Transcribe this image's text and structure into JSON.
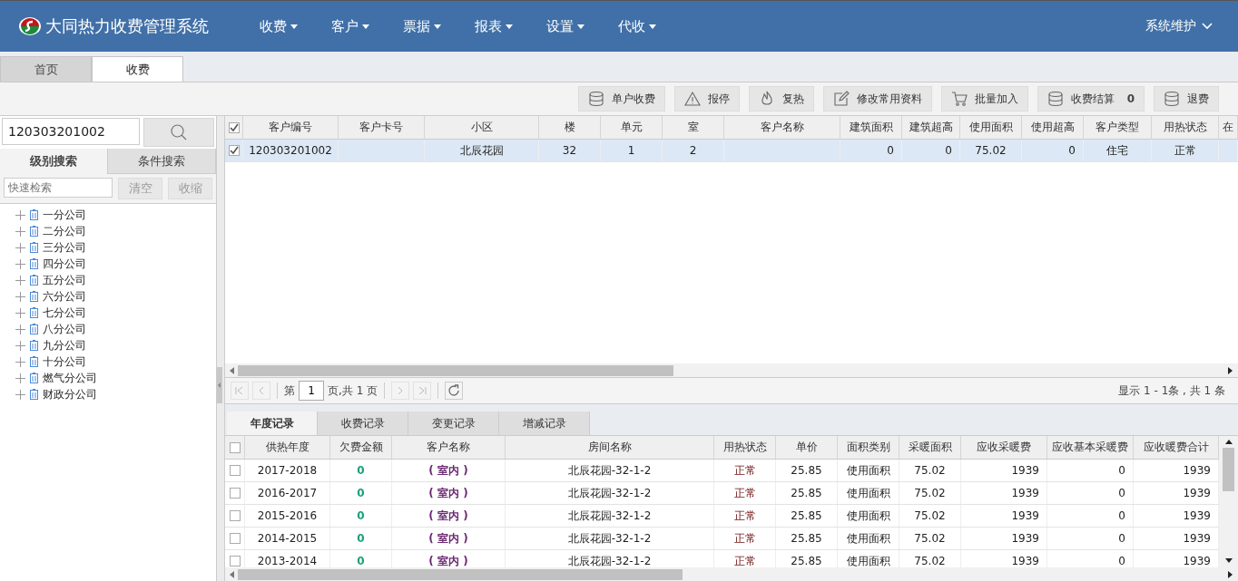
{
  "app": {
    "title": "大同热力收费管理系统",
    "menu": [
      {
        "label": "收费"
      },
      {
        "label": "客户"
      },
      {
        "label": "票据"
      },
      {
        "label": "报表"
      },
      {
        "label": "设置"
      },
      {
        "label": "代收"
      }
    ],
    "user_menu": "系统维护"
  },
  "page_tabs": [
    {
      "label": "首页",
      "selected": false
    },
    {
      "label": "收费",
      "selected": true
    }
  ],
  "toolbar": [
    {
      "label": "单户收费"
    },
    {
      "label": "报停"
    },
    {
      "label": "复热"
    },
    {
      "label": "修改常用资料"
    },
    {
      "label": "批量加入"
    },
    {
      "label": "收费结算",
      "count": "0"
    },
    {
      "label": "退费"
    }
  ],
  "sidebar": {
    "search_value": "120303201002",
    "tabs": [
      {
        "label": "级别搜索",
        "selected": true
      },
      {
        "label": "条件搜索",
        "selected": false
      }
    ],
    "filter_placeholder": "快速检索",
    "clear_button": "清空",
    "collapse_button": "收缩",
    "tree": [
      {
        "label": "一分公司",
        "expanded": false
      },
      {
        "label": "二分公司",
        "expanded": false
      },
      {
        "label": "三分公司",
        "expanded": false
      },
      {
        "label": "四分公司",
        "expanded": false
      },
      {
        "label": "五分公司",
        "expanded": false
      },
      {
        "label": "六分公司",
        "expanded": false
      },
      {
        "label": "七分公司",
        "expanded": false
      },
      {
        "label": "八分公司",
        "expanded": false
      },
      {
        "label": "九分公司",
        "expanded": false
      },
      {
        "label": "十分公司",
        "expanded": false
      },
      {
        "label": "燃气分公司",
        "expanded": false
      },
      {
        "label": "财政分公司",
        "expanded": false
      }
    ]
  },
  "customer_table": {
    "all_checked": true,
    "columns": [
      "客户编号",
      "客户卡号",
      "小区",
      "楼",
      "单元",
      "室",
      "客户名称",
      "建筑面积",
      "建筑超高",
      "使用面积",
      "使用超高",
      "客户类型",
      "用热状态",
      "在"
    ],
    "rows": [
      {
        "selected": true,
        "checked": true,
        "cells": [
          "120303201002",
          "",
          "北辰花园",
          "32",
          "1",
          "2",
          "",
          "0",
          "0",
          "75.02",
          "0",
          "住宅",
          "正常",
          ""
        ]
      }
    ]
  },
  "pager": {
    "prefix": "第",
    "page": "1",
    "suffix": "页,共 1 页",
    "summary": "显示 1 - 1条 , 共 1 条"
  },
  "detail_tabs": [
    {
      "label": "年度记录",
      "selected": true
    },
    {
      "label": "收费记录",
      "selected": false
    },
    {
      "label": "变更记录",
      "selected": false
    },
    {
      "label": "增减记录",
      "selected": false
    }
  ],
  "year_table": {
    "all_checked": false,
    "columns": [
      "供热年度",
      "欠费金额",
      "客户名称",
      "房间名称",
      "用热状态",
      "单价",
      "面积类别",
      "采暖面积",
      "应收采暖费",
      "应收基本采暖费",
      "应收暖费合计"
    ],
    "rows": [
      {
        "checked": false,
        "cells": [
          "2017-2018",
          "0",
          "( 室内 )",
          "北辰花园-32-1-2",
          "正常",
          "25.85",
          "使用面积",
          "75.02",
          "1939",
          "0",
          "1939"
        ]
      },
      {
        "checked": false,
        "cells": [
          "2016-2017",
          "0",
          "( 室内 )",
          "北辰花园-32-1-2",
          "正常",
          "25.85",
          "使用面积",
          "75.02",
          "1939",
          "0",
          "1939"
        ]
      },
      {
        "checked": false,
        "cells": [
          "2015-2016",
          "0",
          "( 室内 )",
          "北辰花园-32-1-2",
          "正常",
          "25.85",
          "使用面积",
          "75.02",
          "1939",
          "0",
          "1939"
        ]
      },
      {
        "checked": false,
        "cells": [
          "2014-2015",
          "0",
          "( 室内 )",
          "北辰花园-32-1-2",
          "正常",
          "25.85",
          "使用面积",
          "75.02",
          "1939",
          "0",
          "1939"
        ]
      },
      {
        "checked": false,
        "cells": [
          "2013-2014",
          "0",
          "( 室内 )",
          "北辰花园-32-1-2",
          "正常",
          "25.85",
          "使用面积",
          "75.02",
          "1939",
          "0",
          "1939"
        ]
      }
    ]
  }
}
